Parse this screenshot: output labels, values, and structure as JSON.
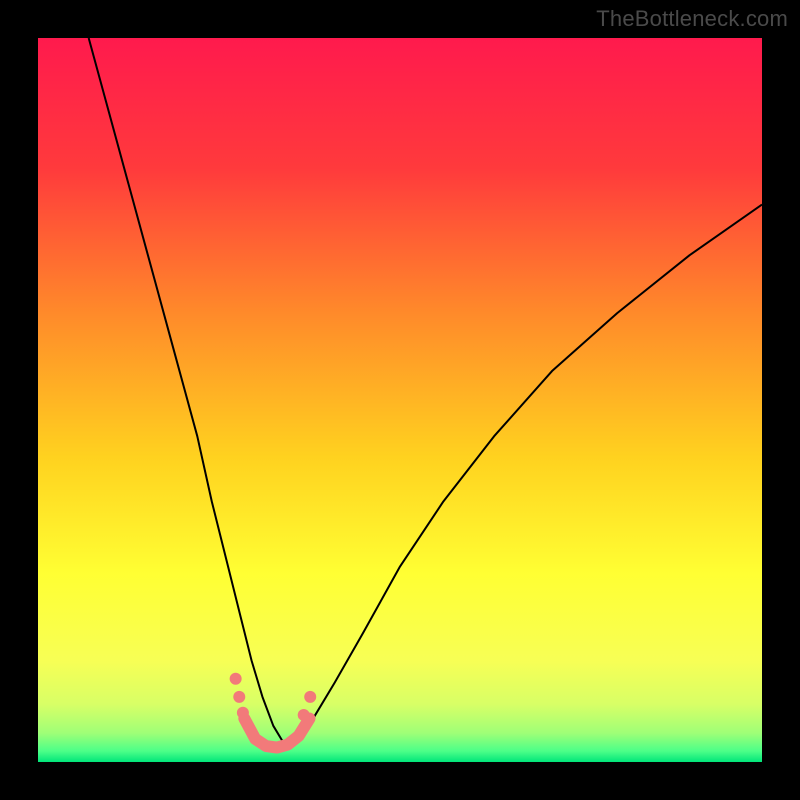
{
  "watermark": "TheBottleneck.com",
  "chart_data": {
    "type": "line",
    "title": "",
    "xlabel": "",
    "ylabel": "",
    "xlim": [
      0,
      100
    ],
    "ylim": [
      0,
      100
    ],
    "grid": false,
    "legend": false,
    "background_gradient_stops": [
      {
        "offset": 0.0,
        "color": "#ff1a4d"
      },
      {
        "offset": 0.18,
        "color": "#ff3a3c"
      },
      {
        "offset": 0.38,
        "color": "#ff8a2a"
      },
      {
        "offset": 0.58,
        "color": "#ffd21f"
      },
      {
        "offset": 0.74,
        "color": "#ffff33"
      },
      {
        "offset": 0.86,
        "color": "#f7ff55"
      },
      {
        "offset": 0.92,
        "color": "#d8ff66"
      },
      {
        "offset": 0.96,
        "color": "#9fff77"
      },
      {
        "offset": 0.985,
        "color": "#4cff88"
      },
      {
        "offset": 1.0,
        "color": "#00e57a"
      }
    ],
    "series": [
      {
        "name": "bottleneck-curve",
        "stroke": "#000000",
        "stroke_width": 2,
        "x": [
          7,
          10,
          13,
          16,
          19,
          22,
          24,
          26,
          28,
          29.5,
          31,
          32.5,
          34,
          36,
          38,
          41,
          45,
          50,
          56,
          63,
          71,
          80,
          90,
          100
        ],
        "y": [
          100,
          89,
          78,
          67,
          56,
          45,
          36,
          28,
          20,
          14,
          9,
          5,
          2.5,
          3,
          6,
          11,
          18,
          27,
          36,
          45,
          54,
          62,
          70,
          77
        ]
      },
      {
        "name": "highlight-band",
        "stroke": "#f27a7a",
        "stroke_width": 12,
        "linecap": "round",
        "x": [
          28.5,
          30,
          31.5,
          33,
          34.5,
          36,
          37.5
        ],
        "y": [
          6,
          3.2,
          2.2,
          2.0,
          2.4,
          3.6,
          6
        ]
      }
    ],
    "points": [
      {
        "x": 27.3,
        "y": 11.5,
        "r": 6,
        "fill": "#f27a7a"
      },
      {
        "x": 27.8,
        "y": 9.0,
        "r": 6,
        "fill": "#f27a7a"
      },
      {
        "x": 28.3,
        "y": 6.8,
        "r": 6,
        "fill": "#f27a7a"
      },
      {
        "x": 36.7,
        "y": 6.5,
        "r": 6,
        "fill": "#f27a7a"
      },
      {
        "x": 37.6,
        "y": 9.0,
        "r": 6,
        "fill": "#f27a7a"
      }
    ]
  }
}
